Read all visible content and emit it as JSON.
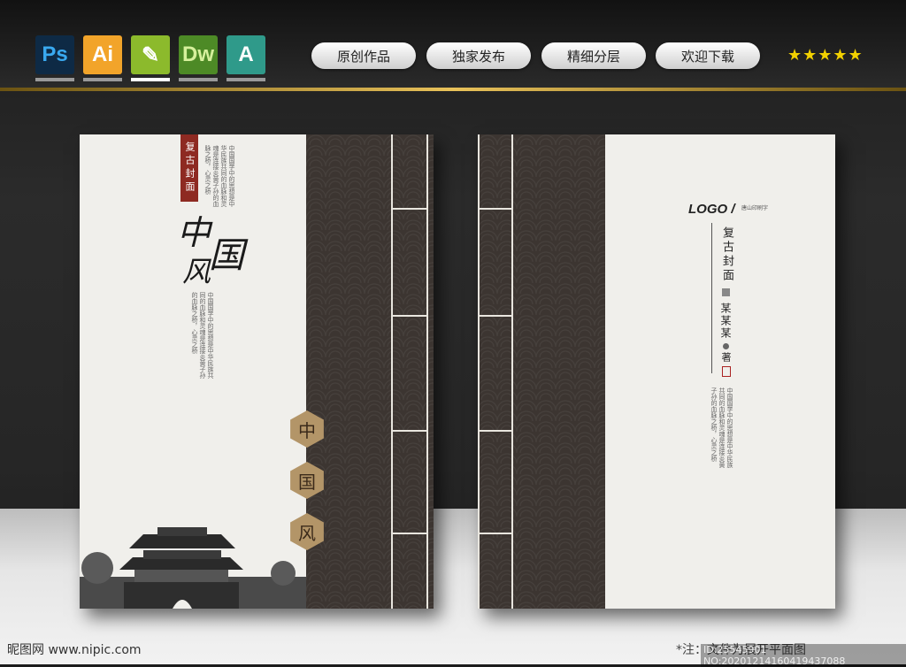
{
  "header": {
    "apps": [
      {
        "name": "ps-icon",
        "label": "Ps",
        "bg": "#0e2a45",
        "fg": "#39a9f0"
      },
      {
        "name": "ai-icon",
        "label": "Ai",
        "bg": "#f2a42a",
        "fg": "#ffffff"
      },
      {
        "name": "cdr-icon",
        "label": "✎",
        "bg": "#8cba2c",
        "fg": "#ffffff"
      },
      {
        "name": "dw-icon",
        "label": "Dw",
        "bg": "#4d8a26",
        "fg": "#d6f09c"
      },
      {
        "name": "autocad-icon",
        "label": "A",
        "bg": "#2f9a8a",
        "fg": "#ffffff"
      }
    ],
    "tags": [
      "原创作品",
      "独家发布",
      "精细分层",
      "欢迎下载"
    ],
    "stars": "★★★★★"
  },
  "front": {
    "red_label": "复古封面",
    "calligraphy": {
      "zhong": "中",
      "guo": "国",
      "feng": "风"
    },
    "poem": [
      "中国国学中的思想是中华",
      "民族共同的血脉和灵魂",
      "是连接炎黄子孙的血脉之",
      "桥，心灵之桥"
    ],
    "poem2": [
      "中国国学中的思想是中华",
      "民族共同的血脉和灵魂",
      "是连接炎黄子孙的血脉之",
      "桥，心灵之桥"
    ],
    "hex": [
      "中",
      "国",
      "风"
    ]
  },
  "back": {
    "logo": "LOGO /",
    "logo_sub": "唐山印刷字",
    "title": "复古封面",
    "author": "某某某",
    "author_suffix": "著",
    "poem": [
      "中国国学中的思想是中华",
      "民族共同的血脉和灵魂",
      "是连接炎黄子孙的血脉之",
      "桥，心灵之桥"
    ]
  },
  "footer": {
    "watermark": "昵图网 www.nipic.com",
    "note": "*注：文件为展开平面图",
    "id": "ID:25545901 NO:20201214160419437088"
  }
}
